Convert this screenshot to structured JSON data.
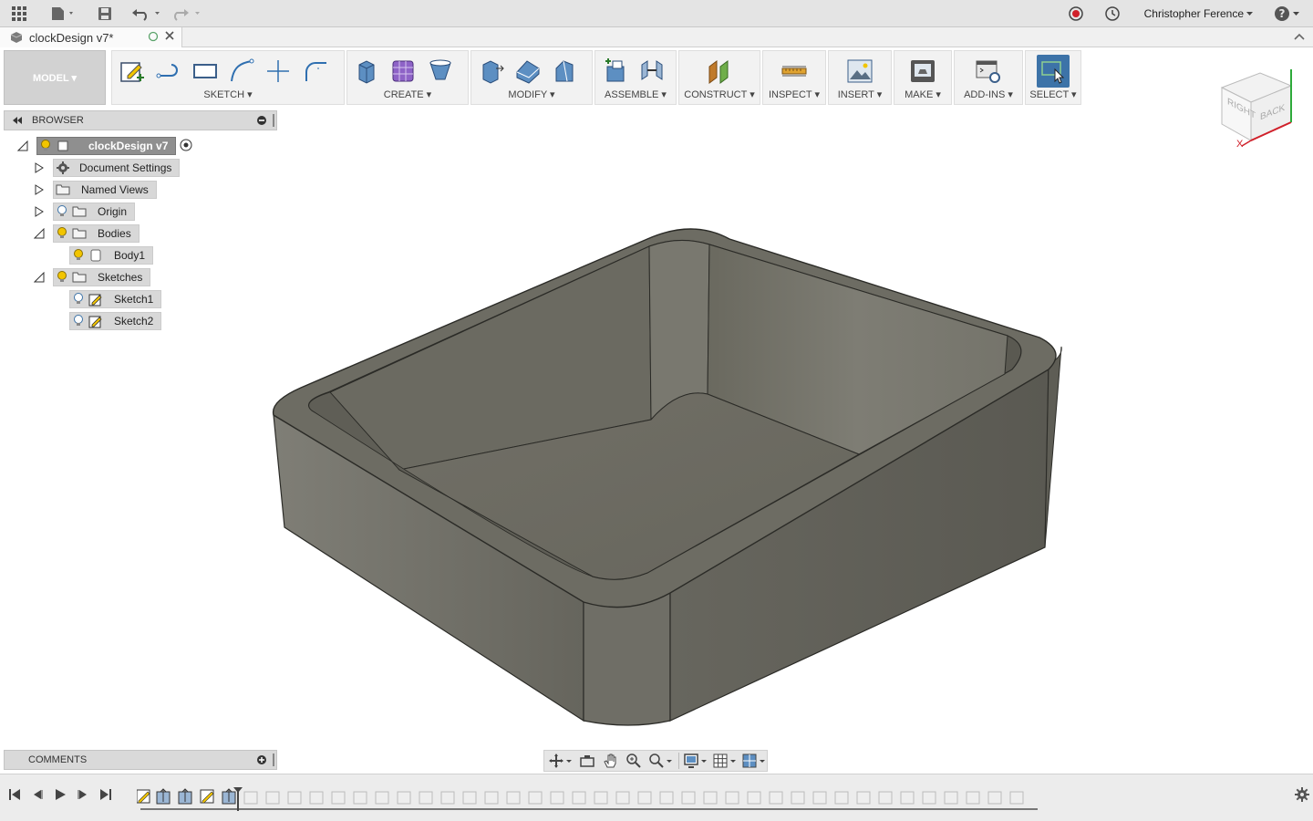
{
  "app": {
    "user_name": "Christopher Ference",
    "document_tab_title": "clockDesign v7*"
  },
  "colors": {
    "select_blue": "#3d73a8",
    "record_red": "#d0202a",
    "bulb_yellow": "#f2c500",
    "body_gray": "#6e6d64"
  },
  "toolbar": {
    "workspace": "MODEL ▾",
    "groups": [
      {
        "id": "sketch",
        "label": "SKETCH ▾"
      },
      {
        "id": "create",
        "label": "CREATE ▾"
      },
      {
        "id": "modify",
        "label": "MODIFY ▾"
      },
      {
        "id": "assemble",
        "label": "ASSEMBLE ▾"
      },
      {
        "id": "construct",
        "label": "CONSTRUCT ▾"
      },
      {
        "id": "inspect",
        "label": "INSPECT ▾"
      },
      {
        "id": "insert",
        "label": "INSERT ▾"
      },
      {
        "id": "make",
        "label": "MAKE ▾"
      },
      {
        "id": "addins",
        "label": "ADD-INS ▾"
      },
      {
        "id": "select",
        "label": "SELECT ▾"
      }
    ]
  },
  "browser": {
    "title": "BROWSER",
    "root": "clockDesign v7",
    "items": [
      {
        "label": "Document Settings"
      },
      {
        "label": "Named Views"
      },
      {
        "label": "Origin"
      },
      {
        "label": "Bodies"
      },
      {
        "label": "Body1"
      },
      {
        "label": "Sketches"
      },
      {
        "label": "Sketch1"
      },
      {
        "label": "Sketch2"
      }
    ]
  },
  "viewcube": {
    "right": "RIGHT",
    "back": "BACK",
    "axis_x": "X"
  },
  "comments": {
    "title": "COMMENTS"
  }
}
